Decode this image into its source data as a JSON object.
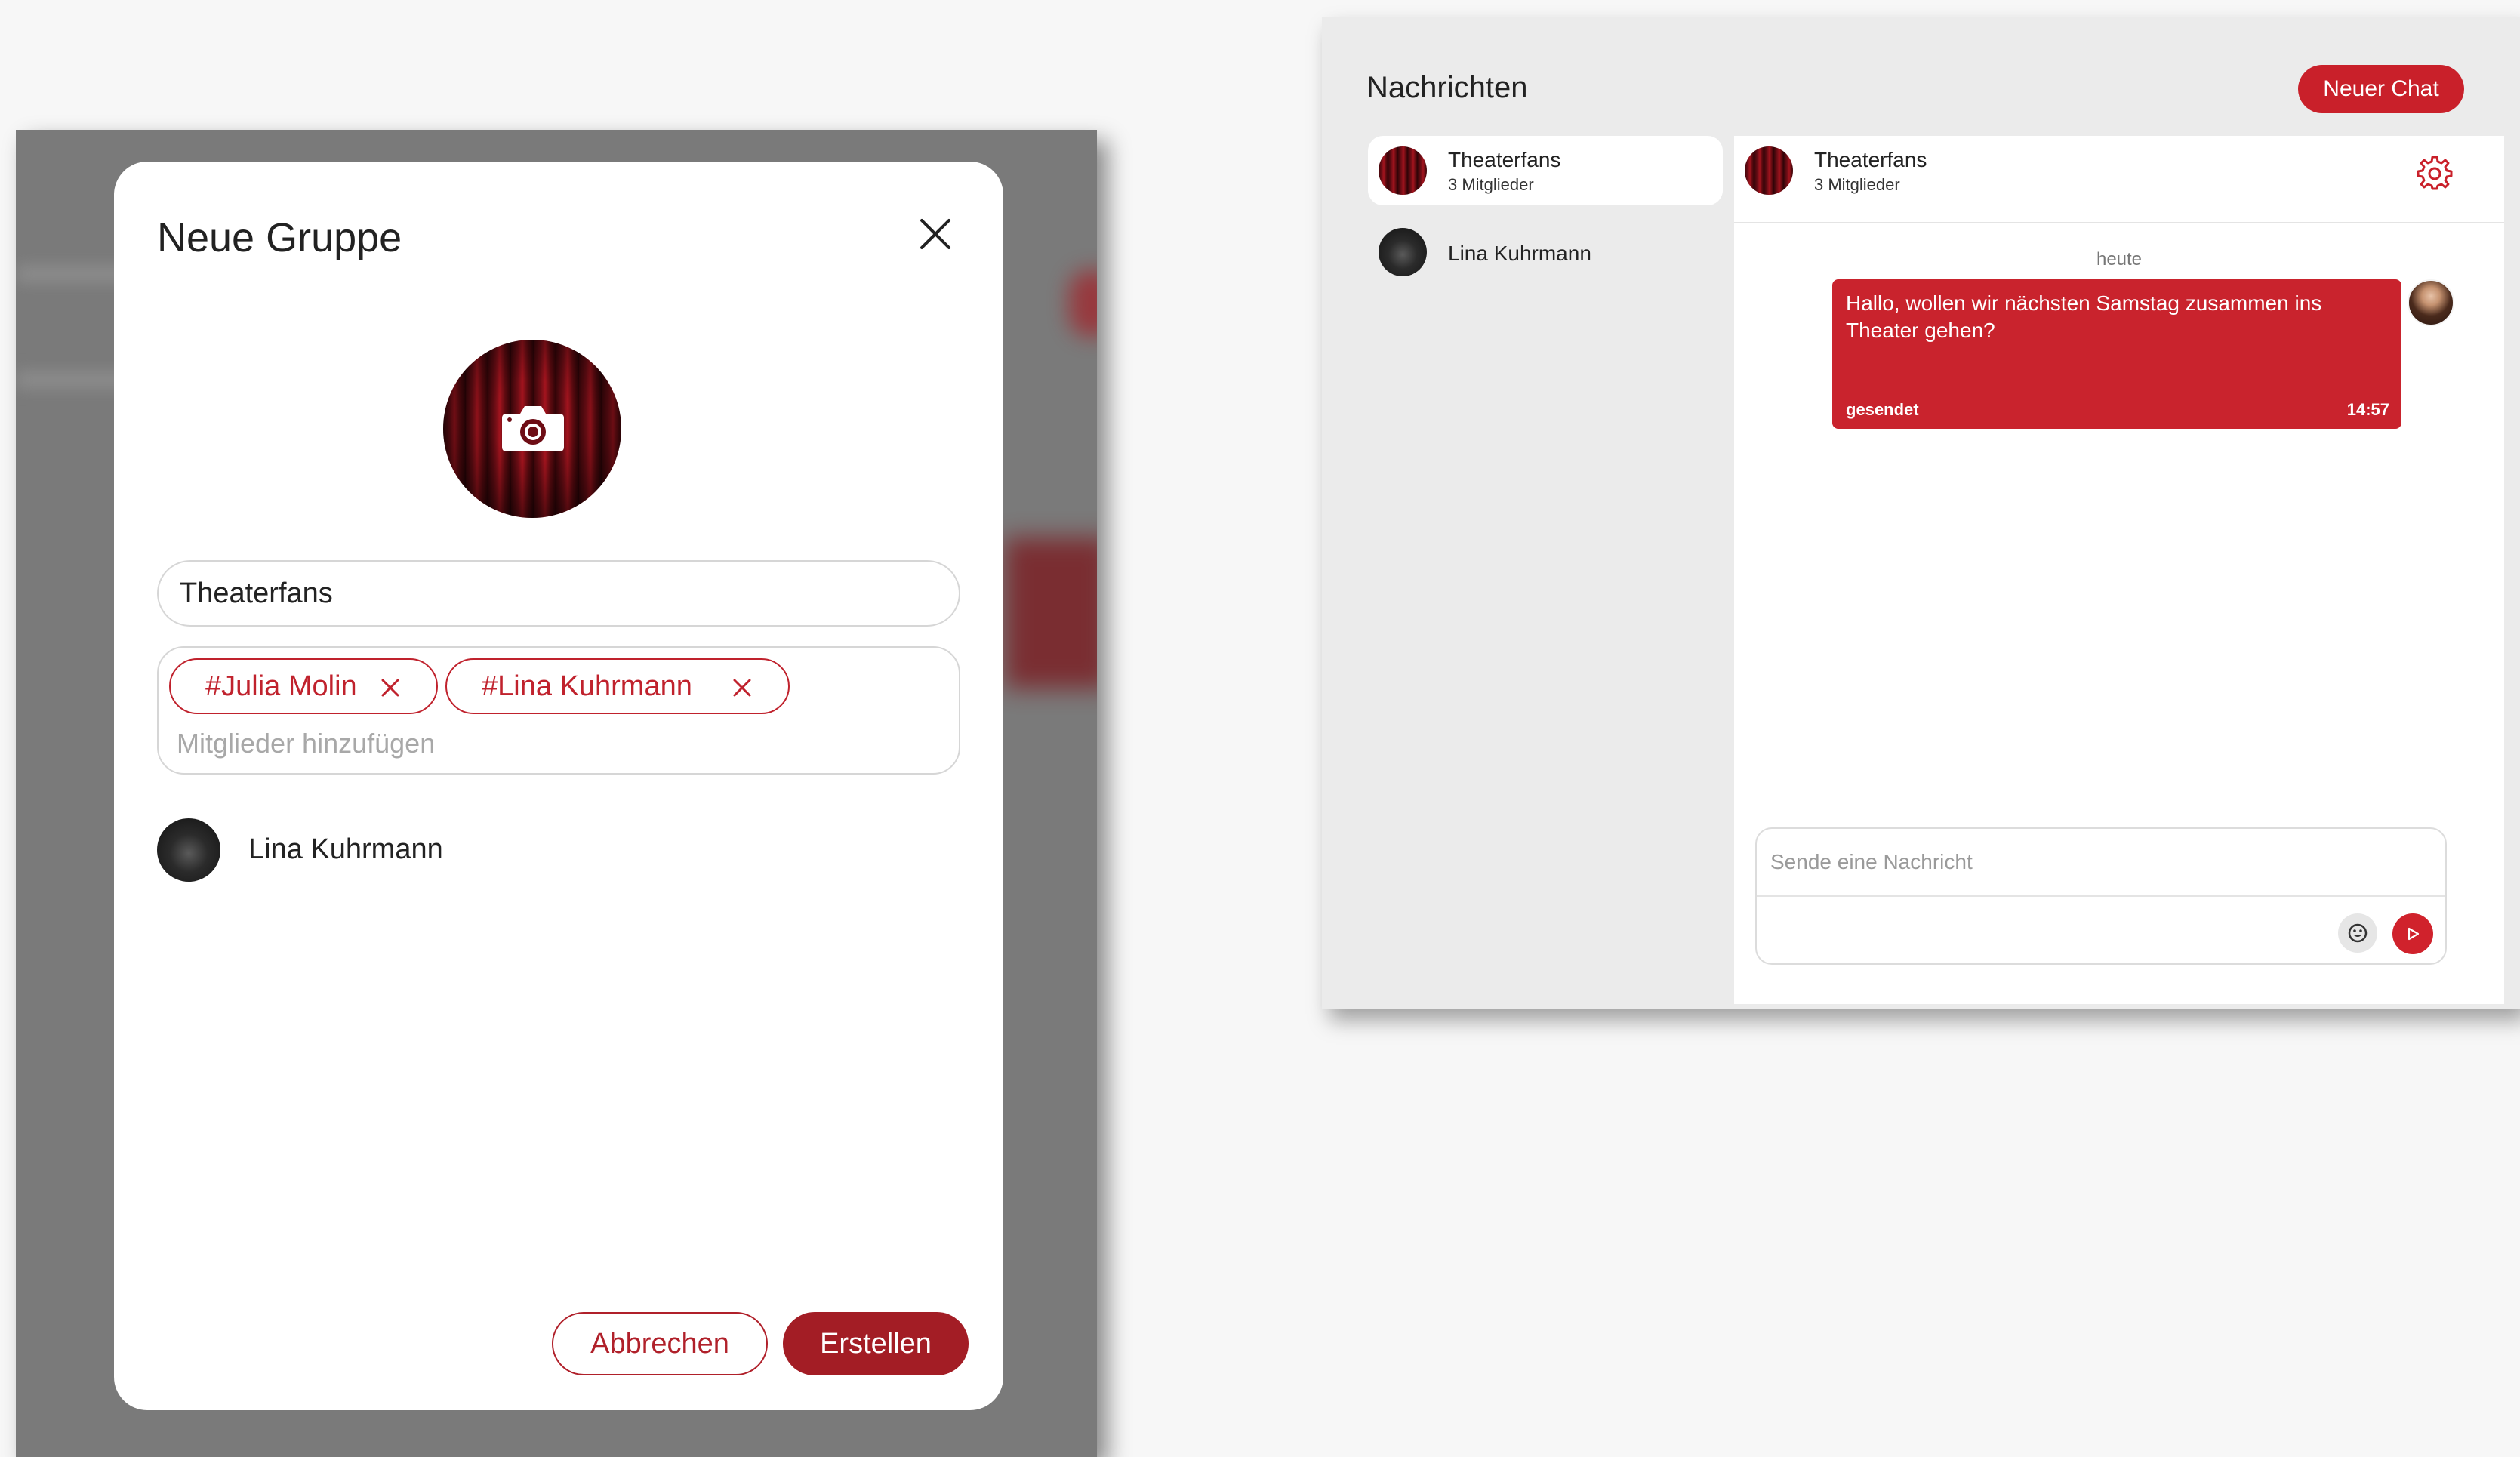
{
  "modal": {
    "title": "Neue Gruppe",
    "group_name_value": "Theaterfans",
    "members": [
      "#Julia Molin",
      "#Lina Kuhrmann"
    ],
    "members_placeholder": "Mitglieder hinzufügen",
    "suggestion_name": "Lina Kuhrmann",
    "cancel_label": "Abbrechen",
    "create_label": "Erstellen",
    "icons": [
      "close-icon",
      "camera-icon",
      "remove-icon"
    ]
  },
  "chat": {
    "title": "Nachrichten",
    "new_chat_label": "Neuer Chat",
    "list": [
      {
        "name": "Theaterfans",
        "subtitle": "3 Mitglieder"
      },
      {
        "name": "Lina Kuhrmann"
      }
    ],
    "header": {
      "name": "Theaterfans",
      "subtitle": "3 Mitglieder"
    },
    "day_label": "heute",
    "message": {
      "text": "Hallo, wollen wir nächsten Samstag zusammen ins Theater gehen?",
      "status": "gesendet",
      "time": "14:57"
    },
    "composer_placeholder": "Sende eine Nachricht",
    "icons": [
      "settings-icon",
      "emoji-icon",
      "send-icon"
    ]
  },
  "colors": {
    "accent": "#c9202a",
    "accent_dark": "#a31d25",
    "overlay": "#7a7a7a",
    "panel_bg": "#ebebeb"
  }
}
